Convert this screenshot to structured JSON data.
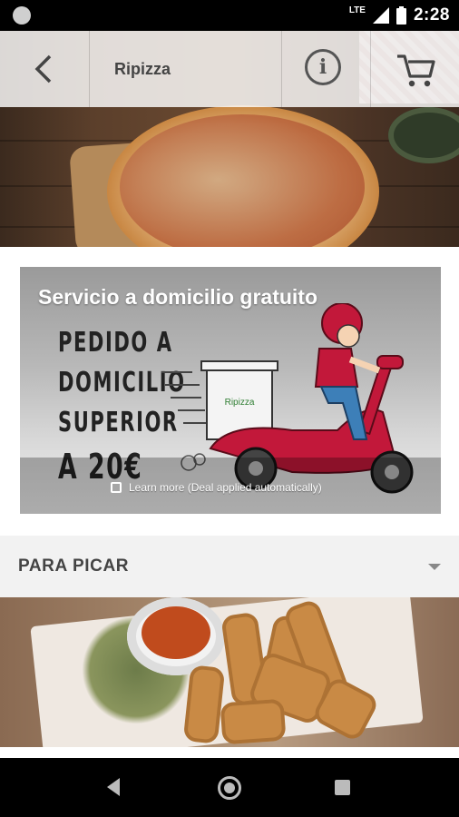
{
  "status_bar": {
    "network_label": "LTE",
    "time": "2:28"
  },
  "header": {
    "back_icon": "chevron-left-icon",
    "title": "Ripizza",
    "info_icon": "info-icon",
    "cart_icon": "cart-icon"
  },
  "promo": {
    "title": "Servicio a domicilio gratuito",
    "lines": [
      "PEDIDO A",
      "DOMICILIO",
      "SUPERIOR",
      "A 20€"
    ],
    "brand_sticker": "Ripizza",
    "learn_more": "Learn more (Deal applied automatically)"
  },
  "category": {
    "label": "PARA PICAR",
    "expand_icon": "caret-down-icon"
  },
  "nav": {
    "back_icon": "nav-back-icon",
    "home_icon": "nav-home-icon",
    "recents_icon": "nav-recents-icon"
  }
}
